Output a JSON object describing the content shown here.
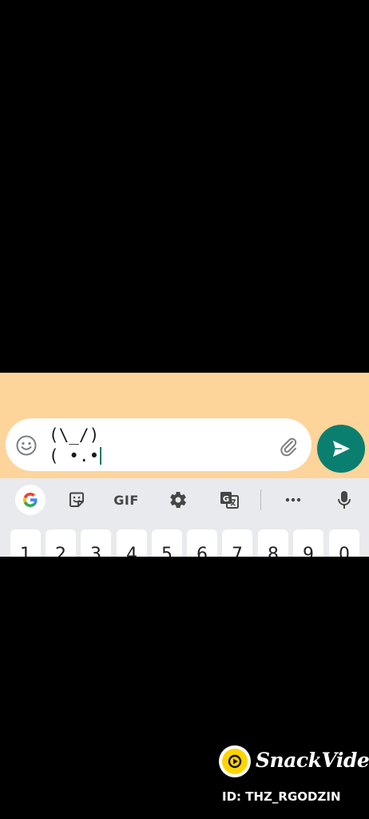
{
  "composer": {
    "message_line1": "(\\_/)",
    "message_line2": "( •.•",
    "emoji_icon": "smiley-icon",
    "attach_icon": "paperclip-icon",
    "send_icon": "send-icon"
  },
  "keyboard": {
    "toolbar": {
      "google_icon": "google-g-icon",
      "sticker_icon": "sticker-icon",
      "gif_label": "GIF",
      "settings_icon": "gear-icon",
      "translate_icon": "translate-icon",
      "more_icon": "more-dots-icon",
      "mic_icon": "mic-icon"
    },
    "number_keys": [
      "1",
      "2",
      "3",
      "4",
      "5",
      "6",
      "7",
      "8",
      "9",
      "0"
    ]
  },
  "watermark": {
    "brand": "SnackVideo",
    "id_text": "ID: THZ_RGODZIN"
  },
  "colors": {
    "chat_background": "#FDD49A",
    "send_button": "#0B7F6F",
    "keyboard_background": "#E8EAED",
    "page_background": "#000000"
  }
}
